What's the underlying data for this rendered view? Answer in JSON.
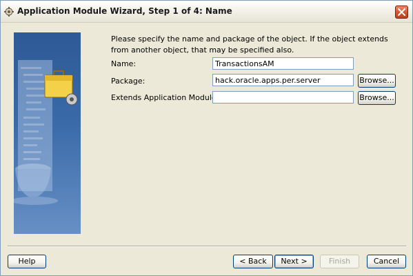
{
  "window": {
    "title": "Application Module Wizard, Step 1 of 4: Name"
  },
  "instructions": "Please specify the name and package of the object.  If the object extends from another object, that may be specified also.",
  "fields": {
    "name": {
      "label": "Name:",
      "value": "TransactionsAM"
    },
    "package": {
      "label": "Package:",
      "value": "hack.oracle.apps.per.server",
      "browse_label": "Browse..."
    },
    "extends": {
      "label": "Extends Application Module:",
      "value": "",
      "browse_label": "Browse..."
    }
  },
  "buttons": {
    "help": "Help",
    "back": "< Back",
    "next": "Next >",
    "finish": "Finish",
    "cancel": "Cancel"
  },
  "icons": {
    "title": "wizard-icon",
    "close": "close-icon",
    "art": "application-module-illustration"
  }
}
